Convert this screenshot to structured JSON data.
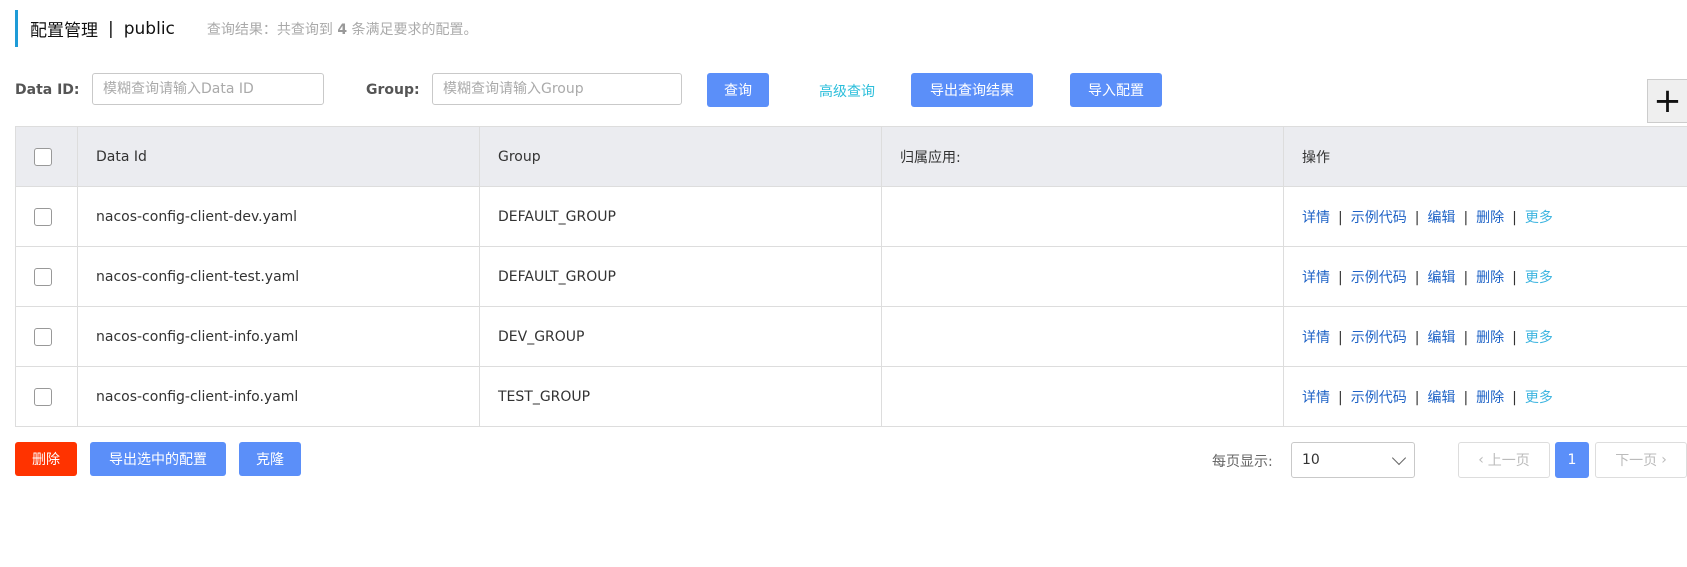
{
  "header": {
    "title": "配置管理",
    "separator": "|",
    "namespace": "public",
    "result_prefix": "查询结果：共查询到",
    "result_count": "4",
    "result_suffix": "条满足要求的配置。"
  },
  "filter": {
    "data_id_label": "Data ID:",
    "data_id_placeholder": "模糊查询请输入Data ID",
    "group_label": "Group:",
    "group_placeholder": "模糊查询请输入Group",
    "search_button": "查询",
    "advanced_search": "高级查询",
    "export_results": "导出查询结果",
    "import_config": "导入配置",
    "add_button": "+"
  },
  "table": {
    "columns": [
      "Data Id",
      "Group",
      "归属应用:",
      "操作"
    ],
    "rows": [
      {
        "data_id": "nacos-config-client-dev.yaml",
        "group": "DEFAULT_GROUP",
        "app": ""
      },
      {
        "data_id": "nacos-config-client-test.yaml",
        "group": "DEFAULT_GROUP",
        "app": ""
      },
      {
        "data_id": "nacos-config-client-info.yaml",
        "group": "DEV_GROUP",
        "app": ""
      },
      {
        "data_id": "nacos-config-client-info.yaml",
        "group": "TEST_GROUP",
        "app": ""
      }
    ],
    "actions": {
      "details": "详情",
      "sample_code": "示例代码",
      "edit": "编辑",
      "delete": "删除",
      "more": "更多",
      "sep": "|"
    }
  },
  "bottom": {
    "delete_button": "删除",
    "export_selected": "导出选中的配置",
    "clone_button": "克隆",
    "page_size_label": "每页显示:",
    "page_size_value": "10",
    "prev_page": "上一页",
    "current_page": "1",
    "next_page": "下一页"
  },
  "colors": {
    "primary": "#5b8ff9",
    "danger": "#ff3300",
    "link": "#1f63c6",
    "accent": "#2bbedb"
  }
}
